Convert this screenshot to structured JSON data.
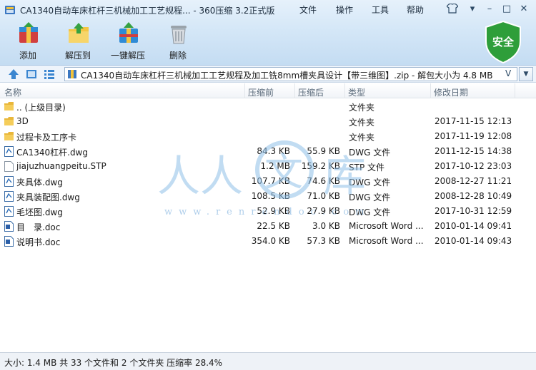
{
  "window": {
    "title": "CA1340自动车床杠杆三机械加工工艺规程... - 360压缩 3.2正式版",
    "menu": [
      "文件",
      "操作",
      "工具",
      "帮助"
    ]
  },
  "toolbar": {
    "add_label": "添加",
    "extract_label": "解压到",
    "one_click_label": "一键解压",
    "delete_label": "删除"
  },
  "security_badge": {
    "label": "安全",
    "color": "#2e9e3a"
  },
  "address": {
    "path": "CA1340自动车床杠杆三机械加工工艺规程及加工铣8mm槽夹具设计【带三维图】.zip - 解包大小为 4.8 MB",
    "dropdown_glyph": "V"
  },
  "columns": {
    "name": "名称",
    "packed": "压缩前",
    "unpacked": "压缩后",
    "type": "类型",
    "modified": "修改日期"
  },
  "files": [
    {
      "name": ".. (上级目录)",
      "before": "",
      "after": "",
      "type": "文件夹",
      "date": "",
      "icon": "folder-icon"
    },
    {
      "name": "3D",
      "before": "",
      "after": "",
      "type": "文件夹",
      "date": "2017-11-15 12:13",
      "icon": "folder-icon"
    },
    {
      "name": "过程卡及工序卡",
      "before": "",
      "after": "",
      "type": "文件夹",
      "date": "2017-11-19 12:08",
      "icon": "folder-icon"
    },
    {
      "name": "CA1340杠杆.dwg",
      "before": "84.3 KB",
      "after": "55.9 KB",
      "type": "DWG 文件",
      "date": "2011-12-15 14:38",
      "icon": "dwg-file-icon"
    },
    {
      "name": "jiajuzhuangpeitu.STP",
      "before": "1.2 MB",
      "after": "159.2 KB",
      "type": "STP 文件",
      "date": "2017-10-12 23:03",
      "icon": "blank-file-icon"
    },
    {
      "name": "夹具体.dwg",
      "before": "107.7 KB",
      "after": "74.6 KB",
      "type": "DWG 文件",
      "date": "2008-12-27 11:21",
      "icon": "dwg-file-icon"
    },
    {
      "name": "夹具装配图.dwg",
      "before": "108.5 KB",
      "after": "71.0 KB",
      "type": "DWG 文件",
      "date": "2008-12-28 10:49",
      "icon": "dwg-file-icon"
    },
    {
      "name": "毛坯图.dwg",
      "before": "52.9 KB",
      "after": "27.9 KB",
      "type": "DWG 文件",
      "date": "2017-10-31 12:59",
      "icon": "dwg-file-icon"
    },
    {
      "name": "目　录.doc",
      "before": "22.5 KB",
      "after": "3.0 KB",
      "type": "Microsoft Word ...",
      "date": "2010-01-14 09:41",
      "icon": "doc-file-icon"
    },
    {
      "name": "说明书.doc",
      "before": "354.0 KB",
      "after": "57.3 KB",
      "type": "Microsoft Word ...",
      "date": "2010-01-14 09:43",
      "icon": "doc-file-icon"
    }
  ],
  "watermark": {
    "text": "www.renrendoc.com"
  },
  "status": {
    "text": "大小: 1.4 MB 共 33 个文件和 2 个文件夹 压缩率 28.4%"
  }
}
